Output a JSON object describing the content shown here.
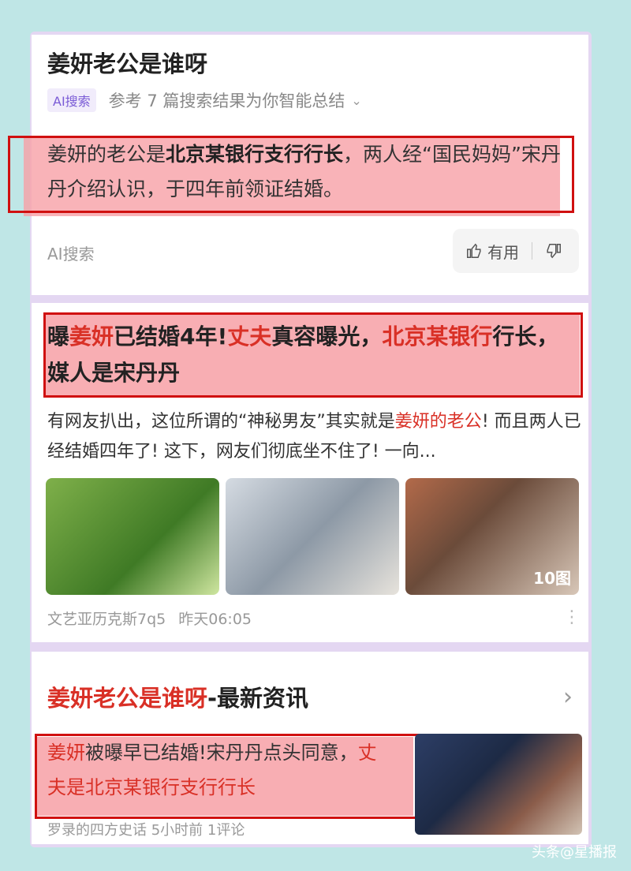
{
  "summary_card": {
    "title": "姜妍老公是谁呀",
    "ai_badge": "AI搜索",
    "ref_text": "参考 7 篇搜索结果为你智能总结",
    "summary_prefix": "姜妍的老公是",
    "summary_bold": "北京某银行支行行长",
    "summary_suffix": "，两人经“国民妈妈”宋丹丹介绍认识，于四年前领证结婚。",
    "footer_label": "AI搜索",
    "useful_label": "有用"
  },
  "article_card": {
    "headline_part1": "曝",
    "headline_hl1": "姜妍",
    "headline_part2": "已结婚4年!",
    "headline_hl2": "丈夫",
    "headline_part3": "真容曝光，",
    "headline_hl3": "北京某银行",
    "headline_part4": "行长，媒人是宋丹丹",
    "snippet_part1": "有网友扒出，这位所谓的“神秘男友”其实就是",
    "snippet_hl": "姜妍的老公",
    "snippet_part2": "! 而且两人已经结婚四年了! 这下，网友们彻底坐不住了! 一向...",
    "image_count": "10图",
    "source": "文艺亚历克斯7q5",
    "time": "昨天06:05"
  },
  "news_card": {
    "title_hl": "姜妍老公是谁呀",
    "title_rest": "-最新资讯",
    "text_hl1": "姜妍",
    "text_part1": "被曝早已结婚!宋丹丹点头同意，",
    "text_hl2": "丈夫是北京某银行支行行长",
    "meta": "罗录的四方史话  5小时前  1评论"
  },
  "watermark": "头条@星播报",
  "colors": {
    "highlight_red": "#d93026",
    "annotation_red": "#d01010",
    "ai_purple": "#7a5bd6"
  }
}
